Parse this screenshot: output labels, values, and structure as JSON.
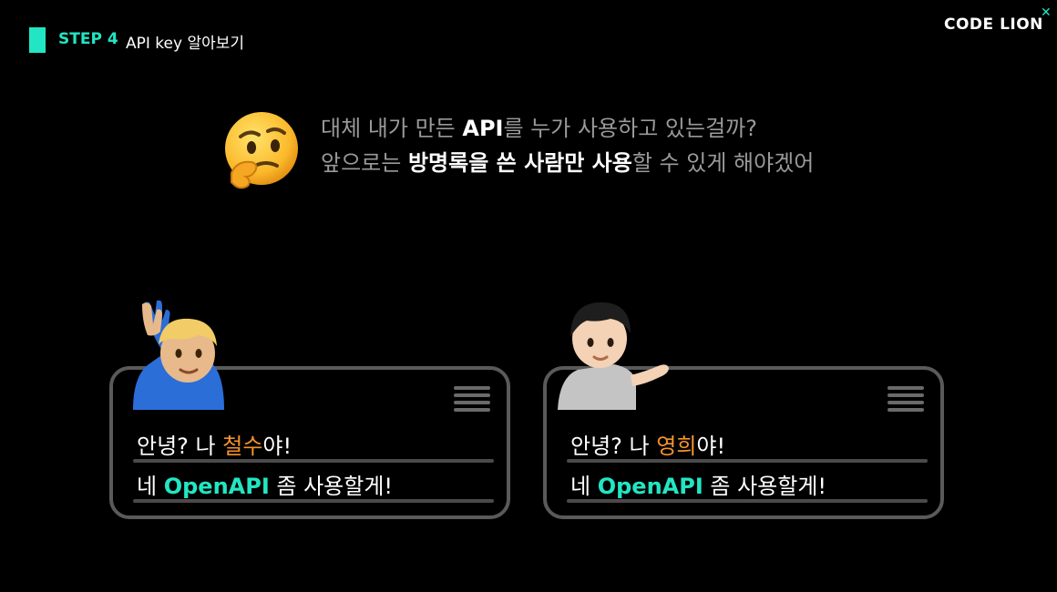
{
  "header": {
    "step": "STEP 4",
    "title": "API key 알아보기"
  },
  "logo": {
    "text": "CODE LION"
  },
  "thought": {
    "line1": {
      "part1": "대체 내가 만든 ",
      "bold1": "API",
      "part2": "를 누가 사용하고 있는걸까?"
    },
    "line2": {
      "part1": "앞으로는 ",
      "bold1": "방명록을 쓴 사람만 사용",
      "part2": "할 수 있게 해야겠어"
    }
  },
  "bubbles": [
    {
      "greet_pre": "안녕? 나 ",
      "name": "철수",
      "greet_post": "야!",
      "line2_pre": "네 ",
      "line2_api": "OpenAPI",
      "line2_post": " 좀 사용할게!"
    },
    {
      "greet_pre": "안녕? 나 ",
      "name": "영희",
      "greet_post": "야!",
      "line2_pre": "네 ",
      "line2_api": "OpenAPI",
      "line2_post": " 좀 사용할게!"
    }
  ],
  "colors": {
    "accent": "#22e6c3",
    "name": "#f5922d",
    "muted": "#9a9a9a"
  },
  "icons": {
    "think": "thinking-face-icon",
    "person_left": "person-raising-hand-icon",
    "person_right": "person-tipping-hand-icon"
  }
}
